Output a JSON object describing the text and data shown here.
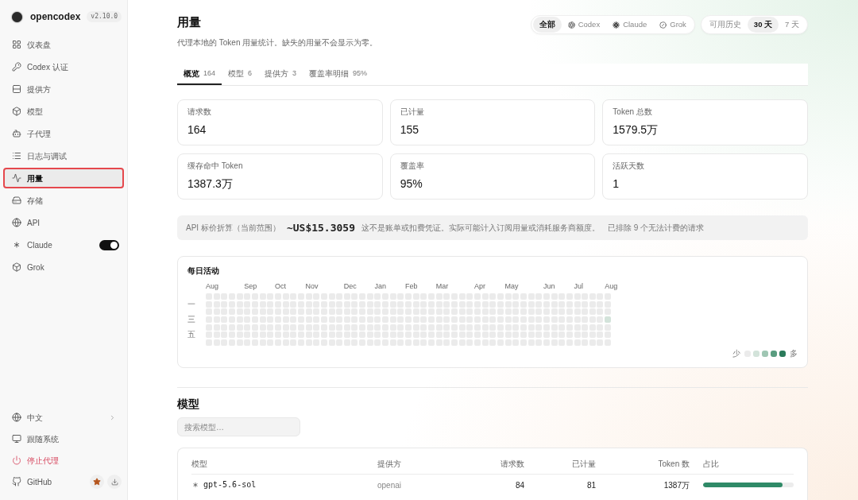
{
  "sidebar": {
    "app_name": "opencodex",
    "version": "v2.10.0",
    "nav": [
      {
        "label": "仪表盘",
        "selected": false
      },
      {
        "label": "Codex 认证",
        "selected": false
      },
      {
        "label": "提供方",
        "selected": false
      },
      {
        "label": "模型",
        "selected": false
      },
      {
        "label": "子代理",
        "selected": false
      },
      {
        "label": "日志与调试",
        "selected": false
      },
      {
        "label": "用量",
        "selected": true
      },
      {
        "label": "存储",
        "selected": false
      },
      {
        "label": "API",
        "selected": false
      },
      {
        "label": "Claude",
        "selected": false,
        "switch_on": true
      },
      {
        "label": "Grok",
        "selected": false
      }
    ],
    "footer": [
      {
        "label": "中文",
        "kind": "menu"
      },
      {
        "label": "跟随系统",
        "kind": "plain"
      },
      {
        "label": "停止代理",
        "kind": "danger"
      },
      {
        "label": "GitHub",
        "kind": "links"
      }
    ]
  },
  "header": {
    "title": "用量",
    "subtitle": "代理本地的 Token 用量统计。缺失的用量不会显示为零。",
    "source_filter": [
      {
        "label": "全部",
        "selected": true
      },
      {
        "label": "Codex",
        "selected": false
      },
      {
        "label": "Claude",
        "selected": false
      },
      {
        "label": "Grok",
        "selected": false
      }
    ],
    "range_filter": [
      {
        "label": "可用历史",
        "selected": false
      },
      {
        "label": "30 天",
        "selected": true
      },
      {
        "label": "7 天",
        "selected": false
      }
    ]
  },
  "tabs": [
    {
      "label": "概览",
      "count": "164",
      "selected": true
    },
    {
      "label": "模型",
      "count": "6",
      "selected": false
    },
    {
      "label": "提供方",
      "count": "3",
      "selected": false
    },
    {
      "label": "覆盖率明细",
      "count": "95%",
      "selected": false
    }
  ],
  "stats": [
    {
      "label": "请求数",
      "value": "164"
    },
    {
      "label": "已计量",
      "value": "155"
    },
    {
      "label": "Token 总数",
      "value": "1579.5万"
    },
    {
      "label": "缓存命中 Token",
      "value": "1387.3万"
    },
    {
      "label": "覆盖率",
      "value": "95%"
    },
    {
      "label": "活跃天数",
      "value": "1"
    }
  ],
  "api_estimate": {
    "label": "API 标价折算（当前范围）",
    "amount": "~US$15.3059",
    "disclaimer": "这不是账单或扣费凭证。实际可能计入订阅用量或消耗服务商额度。",
    "excluded": "已排除 9 个无法计费的请求"
  },
  "activity": {
    "title": "每日活动",
    "day_labels": [
      "一",
      "三",
      "五"
    ],
    "weeks": [
      {
        "month": "Aug",
        "days": [
          {
            "color": "#ebebeb"
          },
          {
            "color": "#ebebeb"
          },
          {
            "color": "#ebebeb"
          },
          {
            "color": "#ebebeb"
          },
          {
            "color": "#ebebeb"
          },
          {
            "color": "#ebebeb"
          },
          {
            "color": "#ebebeb"
          }
        ]
      },
      {
        "days": [
          {
            "color": "#ebebeb"
          },
          {
            "color": "#ebebeb"
          },
          {
            "color": "#ebebeb"
          },
          {
            "color": "#ebebeb"
          },
          {
            "color": "#ebebeb"
          },
          {
            "color": "#ebebeb"
          },
          {
            "color": "#ebebeb"
          }
        ]
      },
      {
        "days": [
          {
            "color": "#ebebeb"
          },
          {
            "color": "#ebebeb"
          },
          {
            "color": "#ebebeb"
          },
          {
            "color": "#ebebeb"
          },
          {
            "color": "#ebebeb"
          },
          {
            "color": "#ebebeb"
          },
          {
            "color": "#ebebeb"
          }
        ]
      },
      {
        "days": [
          {
            "color": "#ebebeb"
          },
          {
            "color": "#ebebeb"
          },
          {
            "color": "#ebebeb"
          },
          {
            "color": "#ebebeb"
          },
          {
            "color": "#ebebeb"
          },
          {
            "color": "#ebebeb"
          },
          {
            "color": "#ebebeb"
          }
        ]
      },
      {
        "days": [
          {
            "color": "#ebebeb"
          },
          {
            "color": "#ebebeb"
          },
          {
            "color": "#ebebeb"
          },
          {
            "color": "#ebebeb"
          },
          {
            "color": "#ebebeb"
          },
          {
            "color": "#ebebeb"
          },
          {
            "color": "#ebebeb"
          }
        ]
      },
      {
        "month": "Sep",
        "days": [
          {
            "color": "#ebebeb"
          },
          {
            "color": "#ebebeb"
          },
          {
            "color": "#ebebeb"
          },
          {
            "color": "#ebebeb"
          },
          {
            "color": "#ebebeb"
          },
          {
            "color": "#ebebeb"
          },
          {
            "color": "#ebebeb"
          }
        ]
      },
      {
        "days": [
          {
            "color": "#ebebeb"
          },
          {
            "color": "#ebebeb"
          },
          {
            "color": "#ebebeb"
          },
          {
            "color": "#ebebeb"
          },
          {
            "color": "#ebebeb"
          },
          {
            "color": "#ebebeb"
          },
          {
            "color": "#ebebeb"
          }
        ]
      },
      {
        "days": [
          {
            "color": "#ebebeb"
          },
          {
            "color": "#ebebeb"
          },
          {
            "color": "#ebebeb"
          },
          {
            "color": "#ebebeb"
          },
          {
            "color": "#ebebeb"
          },
          {
            "color": "#ebebeb"
          },
          {
            "color": "#ebebeb"
          }
        ]
      },
      {
        "days": [
          {
            "color": "#ebebeb"
          },
          {
            "color": "#ebebeb"
          },
          {
            "color": "#ebebeb"
          },
          {
            "color": "#ebebeb"
          },
          {
            "color": "#ebebeb"
          },
          {
            "color": "#ebebeb"
          },
          {
            "color": "#ebebeb"
          }
        ]
      },
      {
        "month": "Oct",
        "days": [
          {
            "color": "#ebebeb"
          },
          {
            "color": "#ebebeb"
          },
          {
            "color": "#ebebeb"
          },
          {
            "color": "#ebebeb"
          },
          {
            "color": "#ebebeb"
          },
          {
            "color": "#ebebeb"
          },
          {
            "color": "#ebebeb"
          }
        ]
      },
      {
        "days": [
          {
            "color": "#ebebeb"
          },
          {
            "color": "#ebebeb"
          },
          {
            "color": "#ebebeb"
          },
          {
            "color": "#ebebeb"
          },
          {
            "color": "#ebebeb"
          },
          {
            "color": "#ebebeb"
          },
          {
            "color": "#ebebeb"
          }
        ]
      },
      {
        "days": [
          {
            "color": "#ebebeb"
          },
          {
            "color": "#ebebeb"
          },
          {
            "color": "#ebebeb"
          },
          {
            "color": "#ebebeb"
          },
          {
            "color": "#ebebeb"
          },
          {
            "color": "#ebebeb"
          },
          {
            "color": "#ebebeb"
          }
        ]
      },
      {
        "days": [
          {
            "color": "#ebebeb"
          },
          {
            "color": "#ebebeb"
          },
          {
            "color": "#ebebeb"
          },
          {
            "color": "#ebebeb"
          },
          {
            "color": "#ebebeb"
          },
          {
            "color": "#ebebeb"
          },
          {
            "color": "#ebebeb"
          }
        ]
      },
      {
        "month": "Nov",
        "days": [
          {
            "color": "#ebebeb"
          },
          {
            "color": "#ebebeb"
          },
          {
            "color": "#ebebeb"
          },
          {
            "color": "#ebebeb"
          },
          {
            "color": "#ebebeb"
          },
          {
            "color": "#ebebeb"
          },
          {
            "color": "#ebebeb"
          }
        ]
      },
      {
        "days": [
          {
            "color": "#ebebeb"
          },
          {
            "color": "#ebebeb"
          },
          {
            "color": "#ebebeb"
          },
          {
            "color": "#ebebeb"
          },
          {
            "color": "#ebebeb"
          },
          {
            "color": "#ebebeb"
          },
          {
            "color": "#ebebeb"
          }
        ]
      },
      {
        "days": [
          {
            "color": "#ebebeb"
          },
          {
            "color": "#ebebeb"
          },
          {
            "color": "#ebebeb"
          },
          {
            "color": "#ebebeb"
          },
          {
            "color": "#ebebeb"
          },
          {
            "color": "#ebebeb"
          },
          {
            "color": "#ebebeb"
          }
        ]
      },
      {
        "days": [
          {
            "color": "#ebebeb"
          },
          {
            "color": "#ebebeb"
          },
          {
            "color": "#ebebeb"
          },
          {
            "color": "#ebebeb"
          },
          {
            "color": "#ebebeb"
          },
          {
            "color": "#ebebeb"
          },
          {
            "color": "#ebebeb"
          }
        ]
      },
      {
        "days": [
          {
            "color": "#ebebeb"
          },
          {
            "color": "#ebebeb"
          },
          {
            "color": "#ebebeb"
          },
          {
            "color": "#ebebeb"
          },
          {
            "color": "#ebebeb"
          },
          {
            "color": "#ebebeb"
          },
          {
            "color": "#ebebeb"
          }
        ]
      },
      {
        "month": "Dec",
        "days": [
          {
            "color": "#ebebeb"
          },
          {
            "color": "#ebebeb"
          },
          {
            "color": "#ebebeb"
          },
          {
            "color": "#ebebeb"
          },
          {
            "color": "#ebebeb"
          },
          {
            "color": "#ebebeb"
          },
          {
            "color": "#ebebeb"
          }
        ]
      },
      {
        "days": [
          {
            "color": "#ebebeb"
          },
          {
            "color": "#ebebeb"
          },
          {
            "color": "#ebebeb"
          },
          {
            "color": "#ebebeb"
          },
          {
            "color": "#ebebeb"
          },
          {
            "color": "#ebebeb"
          },
          {
            "color": "#ebebeb"
          }
        ]
      },
      {
        "days": [
          {
            "color": "#ebebeb"
          },
          {
            "color": "#ebebeb"
          },
          {
            "color": "#ebebeb"
          },
          {
            "color": "#ebebeb"
          },
          {
            "color": "#ebebeb"
          },
          {
            "color": "#ebebeb"
          },
          {
            "color": "#ebebeb"
          }
        ]
      },
      {
        "days": [
          {
            "color": "#ebebeb"
          },
          {
            "color": "#ebebeb"
          },
          {
            "color": "#ebebeb"
          },
          {
            "color": "#ebebeb"
          },
          {
            "color": "#ebebeb"
          },
          {
            "color": "#ebebeb"
          },
          {
            "color": "#ebebeb"
          }
        ]
      },
      {
        "month": "Jan",
        "days": [
          {
            "color": "#ebebeb"
          },
          {
            "color": "#ebebeb"
          },
          {
            "color": "#ebebeb"
          },
          {
            "color": "#ebebeb"
          },
          {
            "color": "#ebebeb"
          },
          {
            "color": "#ebebeb"
          },
          {
            "color": "#ebebeb"
          }
        ]
      },
      {
        "days": [
          {
            "color": "#ebebeb"
          },
          {
            "color": "#ebebeb"
          },
          {
            "color": "#ebebeb"
          },
          {
            "color": "#ebebeb"
          },
          {
            "color": "#ebebeb"
          },
          {
            "color": "#ebebeb"
          },
          {
            "color": "#ebebeb"
          }
        ]
      },
      {
        "days": [
          {
            "color": "#ebebeb"
          },
          {
            "color": "#ebebeb"
          },
          {
            "color": "#ebebeb"
          },
          {
            "color": "#ebebeb"
          },
          {
            "color": "#ebebeb"
          },
          {
            "color": "#ebebeb"
          },
          {
            "color": "#ebebeb"
          }
        ]
      },
      {
        "days": [
          {
            "color": "#ebebeb"
          },
          {
            "color": "#ebebeb"
          },
          {
            "color": "#ebebeb"
          },
          {
            "color": "#ebebeb"
          },
          {
            "color": "#ebebeb"
          },
          {
            "color": "#ebebeb"
          },
          {
            "color": "#ebebeb"
          }
        ]
      },
      {
        "month": "Feb",
        "days": [
          {
            "color": "#ebebeb"
          },
          {
            "color": "#ebebeb"
          },
          {
            "color": "#ebebeb"
          },
          {
            "color": "#ebebeb"
          },
          {
            "color": "#ebebeb"
          },
          {
            "color": "#ebebeb"
          },
          {
            "color": "#ebebeb"
          }
        ]
      },
      {
        "days": [
          {
            "color": "#ebebeb"
          },
          {
            "color": "#ebebeb"
          },
          {
            "color": "#ebebeb"
          },
          {
            "color": "#ebebeb"
          },
          {
            "color": "#ebebeb"
          },
          {
            "color": "#ebebeb"
          },
          {
            "color": "#ebebeb"
          }
        ]
      },
      {
        "days": [
          {
            "color": "#ebebeb"
          },
          {
            "color": "#ebebeb"
          },
          {
            "color": "#ebebeb"
          },
          {
            "color": "#ebebeb"
          },
          {
            "color": "#ebebeb"
          },
          {
            "color": "#ebebeb"
          },
          {
            "color": "#ebebeb"
          }
        ]
      },
      {
        "days": [
          {
            "color": "#ebebeb"
          },
          {
            "color": "#ebebeb"
          },
          {
            "color": "#ebebeb"
          },
          {
            "color": "#ebebeb"
          },
          {
            "color": "#ebebeb"
          },
          {
            "color": "#ebebeb"
          },
          {
            "color": "#ebebeb"
          }
        ]
      },
      {
        "month": "Mar",
        "days": [
          {
            "color": "#ebebeb"
          },
          {
            "color": "#ebebeb"
          },
          {
            "color": "#ebebeb"
          },
          {
            "color": "#ebebeb"
          },
          {
            "color": "#ebebeb"
          },
          {
            "color": "#ebebeb"
          },
          {
            "color": "#ebebeb"
          }
        ]
      },
      {
        "days": [
          {
            "color": "#ebebeb"
          },
          {
            "color": "#ebebeb"
          },
          {
            "color": "#ebebeb"
          },
          {
            "color": "#ebebeb"
          },
          {
            "color": "#ebebeb"
          },
          {
            "color": "#ebebeb"
          },
          {
            "color": "#ebebeb"
          }
        ]
      },
      {
        "days": [
          {
            "color": "#ebebeb"
          },
          {
            "color": "#ebebeb"
          },
          {
            "color": "#ebebeb"
          },
          {
            "color": "#ebebeb"
          },
          {
            "color": "#ebebeb"
          },
          {
            "color": "#ebebeb"
          },
          {
            "color": "#ebebeb"
          }
        ]
      },
      {
        "days": [
          {
            "color": "#ebebeb"
          },
          {
            "color": "#ebebeb"
          },
          {
            "color": "#ebebeb"
          },
          {
            "color": "#ebebeb"
          },
          {
            "color": "#ebebeb"
          },
          {
            "color": "#ebebeb"
          },
          {
            "color": "#ebebeb"
          }
        ]
      },
      {
        "days": [
          {
            "color": "#ebebeb"
          },
          {
            "color": "#ebebeb"
          },
          {
            "color": "#ebebeb"
          },
          {
            "color": "#ebebeb"
          },
          {
            "color": "#ebebeb"
          },
          {
            "color": "#ebebeb"
          },
          {
            "color": "#ebebeb"
          }
        ]
      },
      {
        "month": "Apr",
        "days": [
          {
            "color": "#ebebeb"
          },
          {
            "color": "#ebebeb"
          },
          {
            "color": "#ebebeb"
          },
          {
            "color": "#ebebeb"
          },
          {
            "color": "#ebebeb"
          },
          {
            "color": "#ebebeb"
          },
          {
            "color": "#ebebeb"
          }
        ]
      },
      {
        "days": [
          {
            "color": "#ebebeb"
          },
          {
            "color": "#ebebeb"
          },
          {
            "color": "#ebebeb"
          },
          {
            "color": "#ebebeb"
          },
          {
            "color": "#ebebeb"
          },
          {
            "color": "#ebebeb"
          },
          {
            "color": "#ebebeb"
          }
        ]
      },
      {
        "days": [
          {
            "color": "#ebebeb"
          },
          {
            "color": "#ebebeb"
          },
          {
            "color": "#ebebeb"
          },
          {
            "color": "#ebebeb"
          },
          {
            "color": "#ebebeb"
          },
          {
            "color": "#ebebeb"
          },
          {
            "color": "#ebebeb"
          }
        ]
      },
      {
        "days": [
          {
            "color": "#ebebeb"
          },
          {
            "color": "#ebebeb"
          },
          {
            "color": "#ebebeb"
          },
          {
            "color": "#ebebeb"
          },
          {
            "color": "#ebebeb"
          },
          {
            "color": "#ebebeb"
          },
          {
            "color": "#ebebeb"
          }
        ]
      },
      {
        "month": "May",
        "days": [
          {
            "color": "#ebebeb"
          },
          {
            "color": "#ebebeb"
          },
          {
            "color": "#ebebeb"
          },
          {
            "color": "#ebebeb"
          },
          {
            "color": "#ebebeb"
          },
          {
            "color": "#ebebeb"
          },
          {
            "color": "#ebebeb"
          }
        ]
      },
      {
        "days": [
          {
            "color": "#ebebeb"
          },
          {
            "color": "#ebebeb"
          },
          {
            "color": "#ebebeb"
          },
          {
            "color": "#ebebeb"
          },
          {
            "color": "#ebebeb"
          },
          {
            "color": "#ebebeb"
          },
          {
            "color": "#ebebeb"
          }
        ]
      },
      {
        "days": [
          {
            "color": "#ebebeb"
          },
          {
            "color": "#ebebeb"
          },
          {
            "color": "#ebebeb"
          },
          {
            "color": "#ebebeb"
          },
          {
            "color": "#ebebeb"
          },
          {
            "color": "#ebebeb"
          },
          {
            "color": "#ebebeb"
          }
        ]
      },
      {
        "days": [
          {
            "color": "#ebebeb"
          },
          {
            "color": "#ebebeb"
          },
          {
            "color": "#ebebeb"
          },
          {
            "color": "#ebebeb"
          },
          {
            "color": "#ebebeb"
          },
          {
            "color": "#ebebeb"
          },
          {
            "color": "#ebebeb"
          }
        ]
      },
      {
        "days": [
          {
            "color": "#ebebeb"
          },
          {
            "color": "#ebebeb"
          },
          {
            "color": "#ebebeb"
          },
          {
            "color": "#ebebeb"
          },
          {
            "color": "#ebebeb"
          },
          {
            "color": "#ebebeb"
          },
          {
            "color": "#ebebeb"
          }
        ]
      },
      {
        "month": "Jun",
        "days": [
          {
            "color": "#ebebeb"
          },
          {
            "color": "#ebebeb"
          },
          {
            "color": "#ebebeb"
          },
          {
            "color": "#ebebeb"
          },
          {
            "color": "#ebebeb"
          },
          {
            "color": "#ebebeb"
          },
          {
            "color": "#ebebeb"
          }
        ]
      },
      {
        "days": [
          {
            "color": "#ebebeb"
          },
          {
            "color": "#ebebeb"
          },
          {
            "color": "#ebebeb"
          },
          {
            "color": "#ebebeb"
          },
          {
            "color": "#ebebeb"
          },
          {
            "color": "#ebebeb"
          },
          {
            "color": "#ebebeb"
          }
        ]
      },
      {
        "days": [
          {
            "color": "#ebebeb"
          },
          {
            "color": "#ebebeb"
          },
          {
            "color": "#ebebeb"
          },
          {
            "color": "#ebebeb"
          },
          {
            "color": "#ebebeb"
          },
          {
            "color": "#ebebeb"
          },
          {
            "color": "#ebebeb"
          }
        ]
      },
      {
        "days": [
          {
            "color": "#ebebeb"
          },
          {
            "color": "#ebebeb"
          },
          {
            "color": "#ebebeb"
          },
          {
            "color": "#ebebeb"
          },
          {
            "color": "#ebebeb"
          },
          {
            "color": "#ebebeb"
          },
          {
            "color": "#ebebeb"
          }
        ]
      },
      {
        "month": "Jul",
        "days": [
          {
            "color": "#ebebeb"
          },
          {
            "color": "#ebebeb"
          },
          {
            "color": "#ebebeb"
          },
          {
            "color": "#ebebeb"
          },
          {
            "color": "#ebebeb"
          },
          {
            "color": "#ebebeb"
          },
          {
            "color": "#ebebeb"
          }
        ]
      },
      {
        "days": [
          {
            "color": "#ebebeb"
          },
          {
            "color": "#ebebeb"
          },
          {
            "color": "#ebebeb"
          },
          {
            "color": "#ebebeb"
          },
          {
            "color": "#ebebeb"
          },
          {
            "color": "#ebebeb"
          },
          {
            "color": "#ebebeb"
          }
        ]
      },
      {
        "days": [
          {
            "color": "#ebebeb"
          },
          {
            "color": "#ebebeb"
          },
          {
            "color": "#ebebeb"
          },
          {
            "color": "#ebebeb"
          },
          {
            "color": "#ebebeb"
          },
          {
            "color": "#ebebeb"
          },
          {
            "color": "#ebebeb"
          }
        ]
      },
      {
        "days": [
          {
            "color": "#ebebeb"
          },
          {
            "color": "#ebebeb"
          },
          {
            "color": "#ebebeb"
          },
          {
            "color": "#ebebeb"
          },
          {
            "color": "#ebebeb"
          },
          {
            "color": "#ebebeb"
          },
          {
            "color": "#ebebeb"
          }
        ]
      },
      {
        "month": "Aug",
        "days": [
          {
            "color": "#ebebeb"
          },
          {
            "color": "#ebebeb"
          },
          {
            "color": "#ebebeb"
          },
          {
            "color": "#d3e3da"
          },
          {
            "color": "#ebebeb"
          },
          {
            "color": "#ebebeb"
          },
          {
            "color": "#ebebeb"
          }
        ]
      }
    ],
    "legend": {
      "less": "少",
      "more": "多",
      "swatches": [
        {
          "color": "#ebebeb"
        },
        {
          "color": "#d3e3da"
        },
        {
          "color": "#9fc6b3"
        },
        {
          "color": "#5a9d80"
        },
        {
          "color": "#2a7a5a"
        }
      ]
    }
  },
  "models": {
    "title": "模型",
    "search": {
      "placeholder": "搜索模型…"
    },
    "table": {
      "columns": [
        {
          "label": "模型"
        },
        {
          "label": "提供方"
        },
        {
          "label": "请求数"
        },
        {
          "label": "已计量"
        },
        {
          "label": "Token 数"
        },
        {
          "label": "占比"
        }
      ],
      "rows": [
        {
          "model": "gpt-5.6-sol",
          "provider": "openai",
          "requests": "84",
          "billed": "81",
          "tokens": "1387万",
          "level": 0.88
        }
      ]
    }
  }
}
